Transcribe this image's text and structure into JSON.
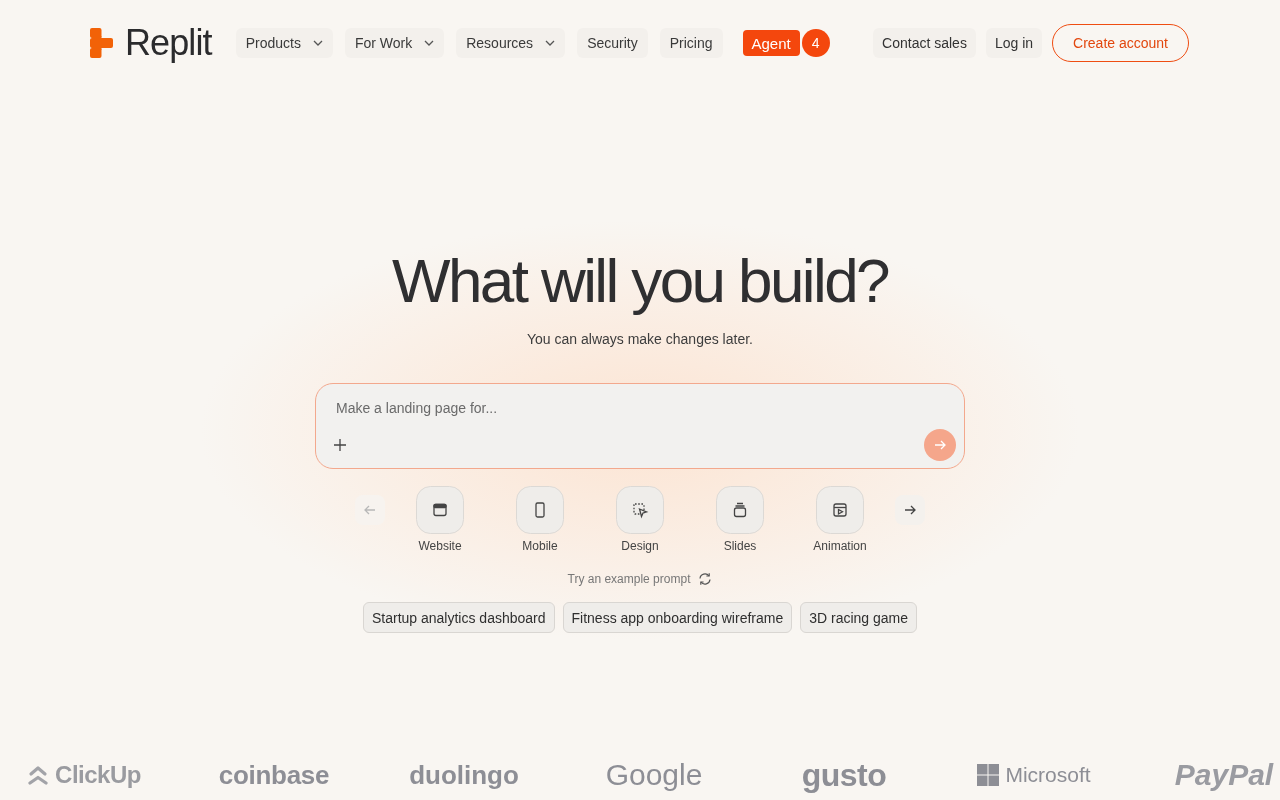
{
  "header": {
    "logo": "Replit",
    "nav": [
      {
        "label": "Products",
        "kind": "dropdown"
      },
      {
        "label": "For Work",
        "kind": "dropdown"
      },
      {
        "label": "Resources",
        "kind": "dropdown"
      },
      {
        "label": "Security",
        "kind": "link"
      },
      {
        "label": "Pricing",
        "kind": "link"
      }
    ],
    "agent": {
      "label": "Agent",
      "badge": "4"
    },
    "actions": [
      {
        "label": "Contact sales",
        "kind": "ghost"
      },
      {
        "label": "Log in",
        "kind": "ghost"
      },
      {
        "label": "Create account",
        "kind": "outline"
      }
    ]
  },
  "hero": {
    "title": "What will you build?",
    "subtitle": "You can always make changes later."
  },
  "prompt": {
    "placeholder": "Make a landing page for...",
    "send_disabled": true
  },
  "categories": {
    "prev_disabled": true,
    "next_disabled": false,
    "items": [
      {
        "label": "Website",
        "kind": "website"
      },
      {
        "label": "Mobile",
        "kind": "mobile"
      },
      {
        "label": "Design",
        "kind": "design"
      },
      {
        "label": "Slides",
        "kind": "slides"
      },
      {
        "label": "Animation",
        "kind": "animation"
      }
    ]
  },
  "examples": {
    "label": "Try an example prompt",
    "prompts": [
      "Startup analytics dashboard",
      "Fitness app onboarding wireframe",
      "3D racing game"
    ]
  },
  "logos": [
    {
      "name": "ClickUp",
      "kind": "clickup"
    },
    {
      "name": "coinbase",
      "kind": "coinbase"
    },
    {
      "name": "duolingo",
      "kind": "duolingo"
    },
    {
      "name": "Google",
      "kind": "google"
    },
    {
      "name": "gusto",
      "kind": "gusto"
    },
    {
      "name": "Microsoft",
      "kind": "microsoft"
    },
    {
      "name": "PayPal",
      "kind": "paypal"
    }
  ]
}
